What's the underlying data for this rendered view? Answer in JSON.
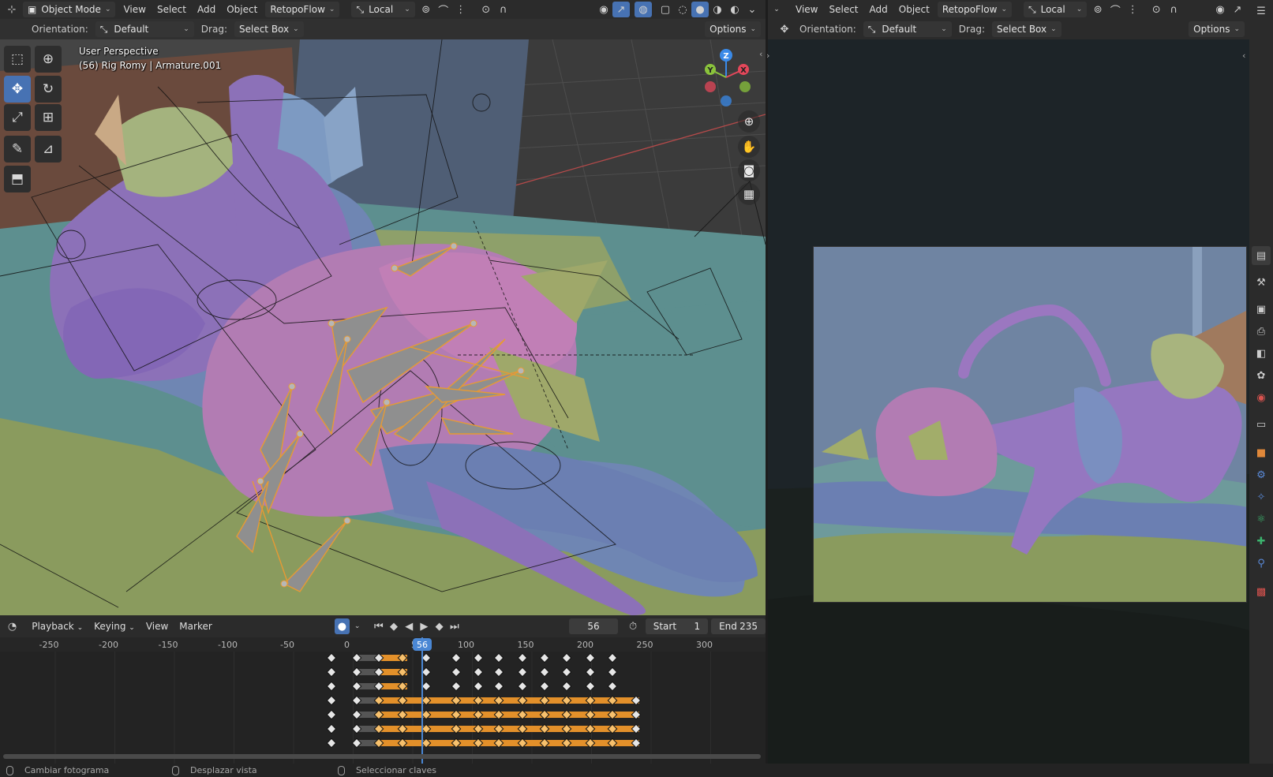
{
  "left_header": {
    "mode": "Object Mode",
    "menus": [
      "View",
      "Select",
      "Add",
      "Object"
    ],
    "addon": "RetopoFlow",
    "transform_orientation": "Local"
  },
  "left_tool_header": {
    "orientation_label": "Orientation:",
    "orientation_value": "Default",
    "drag_label": "Drag:",
    "drag_value": "Select Box",
    "options": "Options"
  },
  "viewport": {
    "perspective": "User Perspective",
    "object_info": "(56) Rig Romy | Armature.001",
    "gizmo_axes": {
      "z": "Z",
      "y": "Y",
      "x": "X"
    }
  },
  "timeline": {
    "header": {
      "playback": "Playback",
      "keying": "Keying",
      "view": "View",
      "marker": "Marker",
      "current_frame": "56",
      "start_label": "Start",
      "start_value": "1",
      "end_label": "End",
      "end_value": "235"
    },
    "ruler_ticks": [
      "-250",
      "-200",
      "-150",
      "-100",
      "-50",
      "0",
      "5",
      "100",
      "150",
      "200",
      "250",
      "300"
    ],
    "playhead_label": "56"
  },
  "right_header": {
    "menus": [
      "View",
      "Select",
      "Add",
      "Object"
    ],
    "addon": "RetopoFlow",
    "transform_orientation": "Local"
  },
  "right_tool_header": {
    "orientation_label": "Orientation:",
    "orientation_value": "Default",
    "drag_label": "Drag:",
    "drag_value": "Select Box",
    "options": "Options"
  },
  "statusbar": {
    "hints": [
      "Cambiar fotograma",
      "Desplazar vista",
      "Seleccionar claves"
    ]
  },
  "colors": {
    "accent": "#4772b3",
    "keyframe_selected": "#e3902a",
    "playhead": "#4a87d4",
    "gizmo_x": "#e4475a",
    "gizmo_y": "#8ac33c",
    "gizmo_z": "#3a8ae8"
  },
  "icons": {
    "tools": [
      "select-box-icon",
      "cursor-icon",
      "move-icon",
      "rotate-icon",
      "scale-icon",
      "transform-icon",
      "annotate-icon",
      "measure-icon",
      "add-cube-icon"
    ],
    "nav": [
      "zoom-icon",
      "pan-hand-icon",
      "camera-icon",
      "grid-icon"
    ]
  }
}
